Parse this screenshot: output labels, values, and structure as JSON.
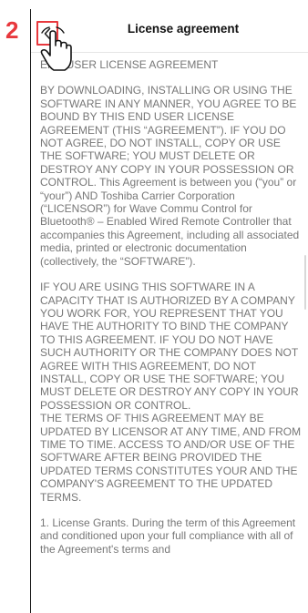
{
  "annotation": {
    "step_number": "2"
  },
  "header": {
    "back_icon": "chevron-left-icon",
    "title": "License agreement"
  },
  "content": {
    "heading": "END USER LICENSE AGREEMENT",
    "paragraph_1": "BY DOWNLOADING, INSTALLING OR USING THE SOFTWARE IN ANY MANNER, YOU AGREE TO BE BOUND BY THIS END USER LICENSE AGREEMENT (THIS “AGREEMENT”).  IF YOU DO NOT AGREE, DO NOT INSTALL, COPY OR USE THE SOFTWARE; YOU MUST DELETE OR DESTROY ANY COPY IN YOUR POSSESSION OR CONTROL. This Agreement is between you (“you” or “your”) AND Toshiba Carrier Corporation (“LICENSOR”) for Wave Commu Control for Bluetooth® – Enabled Wired Remote Controller that accompanies this Agreement, including all associated media, printed or electronic documentation (collectively, the “SOFTWARE”).",
    "paragraph_2": "IF YOU ARE USING THIS SOFTWARE IN A CAPACITY THAT IS AUTHORIZED BY A COMPANY YOU WORK FOR, YOU REPRESENT THAT YOU HAVE THE AUTHORITY TO BIND THE COMPANY TO THIS AGREEMENT.  IF YOU DO NOT HAVE SUCH AUTHORITY OR THE COMPANY DOES NOT AGREE WITH THIS AGREEMENT, DO NOT INSTALL, COPY OR USE THE SOFTWARE; YOU MUST DELETE OR DESTROY ANY COPY IN YOUR POSSESSION OR CONTROL.",
    "paragraph_3": "THE TERMS OF THIS AGREEMENT MAY BE UPDATED BY LICENSOR AT ANY TIME, AND FROM TIME TO TIME. ACCESS TO AND/OR USE OF THE SOFTWARE AFTER BEING PROVIDED THE UPDATED TERMS CONSTITUTES YOUR AND THE COMPANY'S AGREEMENT TO THE UPDATED TERMS.",
    "paragraph_4": "1. License Grants.  During the term of this Agreement and conditioned upon your full compliance with all of the Agreement's terms and"
  },
  "pointer_icon": "hand-pointer-icon",
  "colors": {
    "accent_red": "#e8383d",
    "body_text": "#777777",
    "title_text": "#111111"
  }
}
